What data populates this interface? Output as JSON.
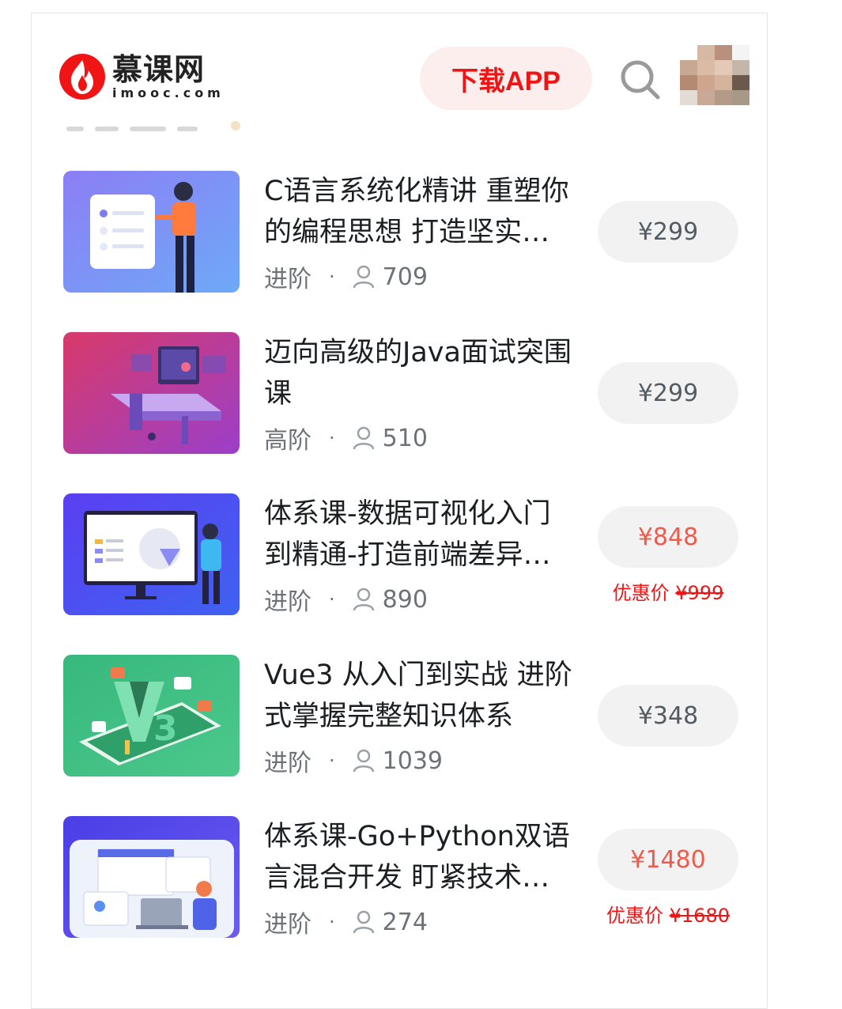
{
  "header": {
    "logo_cn": "慕课网",
    "logo_en": "imooc.com",
    "download_label": "下载APP"
  },
  "colors": {
    "brand_red": "#f01414",
    "price_sale": "#f05a4b",
    "price_normal": "#545c63"
  },
  "courses": [
    {
      "title": "C语言系统化精讲 重塑你的编程思想 打造坚实的开发基础",
      "level": "进阶",
      "dot": "·",
      "students": "709",
      "price": "¥299"
    },
    {
      "title": "迈向高级的Java面试突围课",
      "level": "高阶",
      "dot": "·",
      "students": "510",
      "price": "¥299"
    },
    {
      "title": "体系课-数据可视化入门到精通-打造前端差异化竞争力",
      "level": "进阶",
      "dot": "·",
      "students": "890",
      "price": "¥848",
      "discount_label": "优惠价",
      "original_price": "¥999"
    },
    {
      "title": "Vue3 从入门到实战 进阶式掌握完整知识体系",
      "level": "进阶",
      "dot": "·",
      "students": "1039",
      "price": "¥348"
    },
    {
      "title": "体系课-Go+Python双语言混合开发 盯紧技术先机",
      "level": "进阶",
      "dot": "·",
      "students": "274",
      "price": "¥1480",
      "discount_label": "优惠价",
      "original_price": "¥1680"
    }
  ]
}
